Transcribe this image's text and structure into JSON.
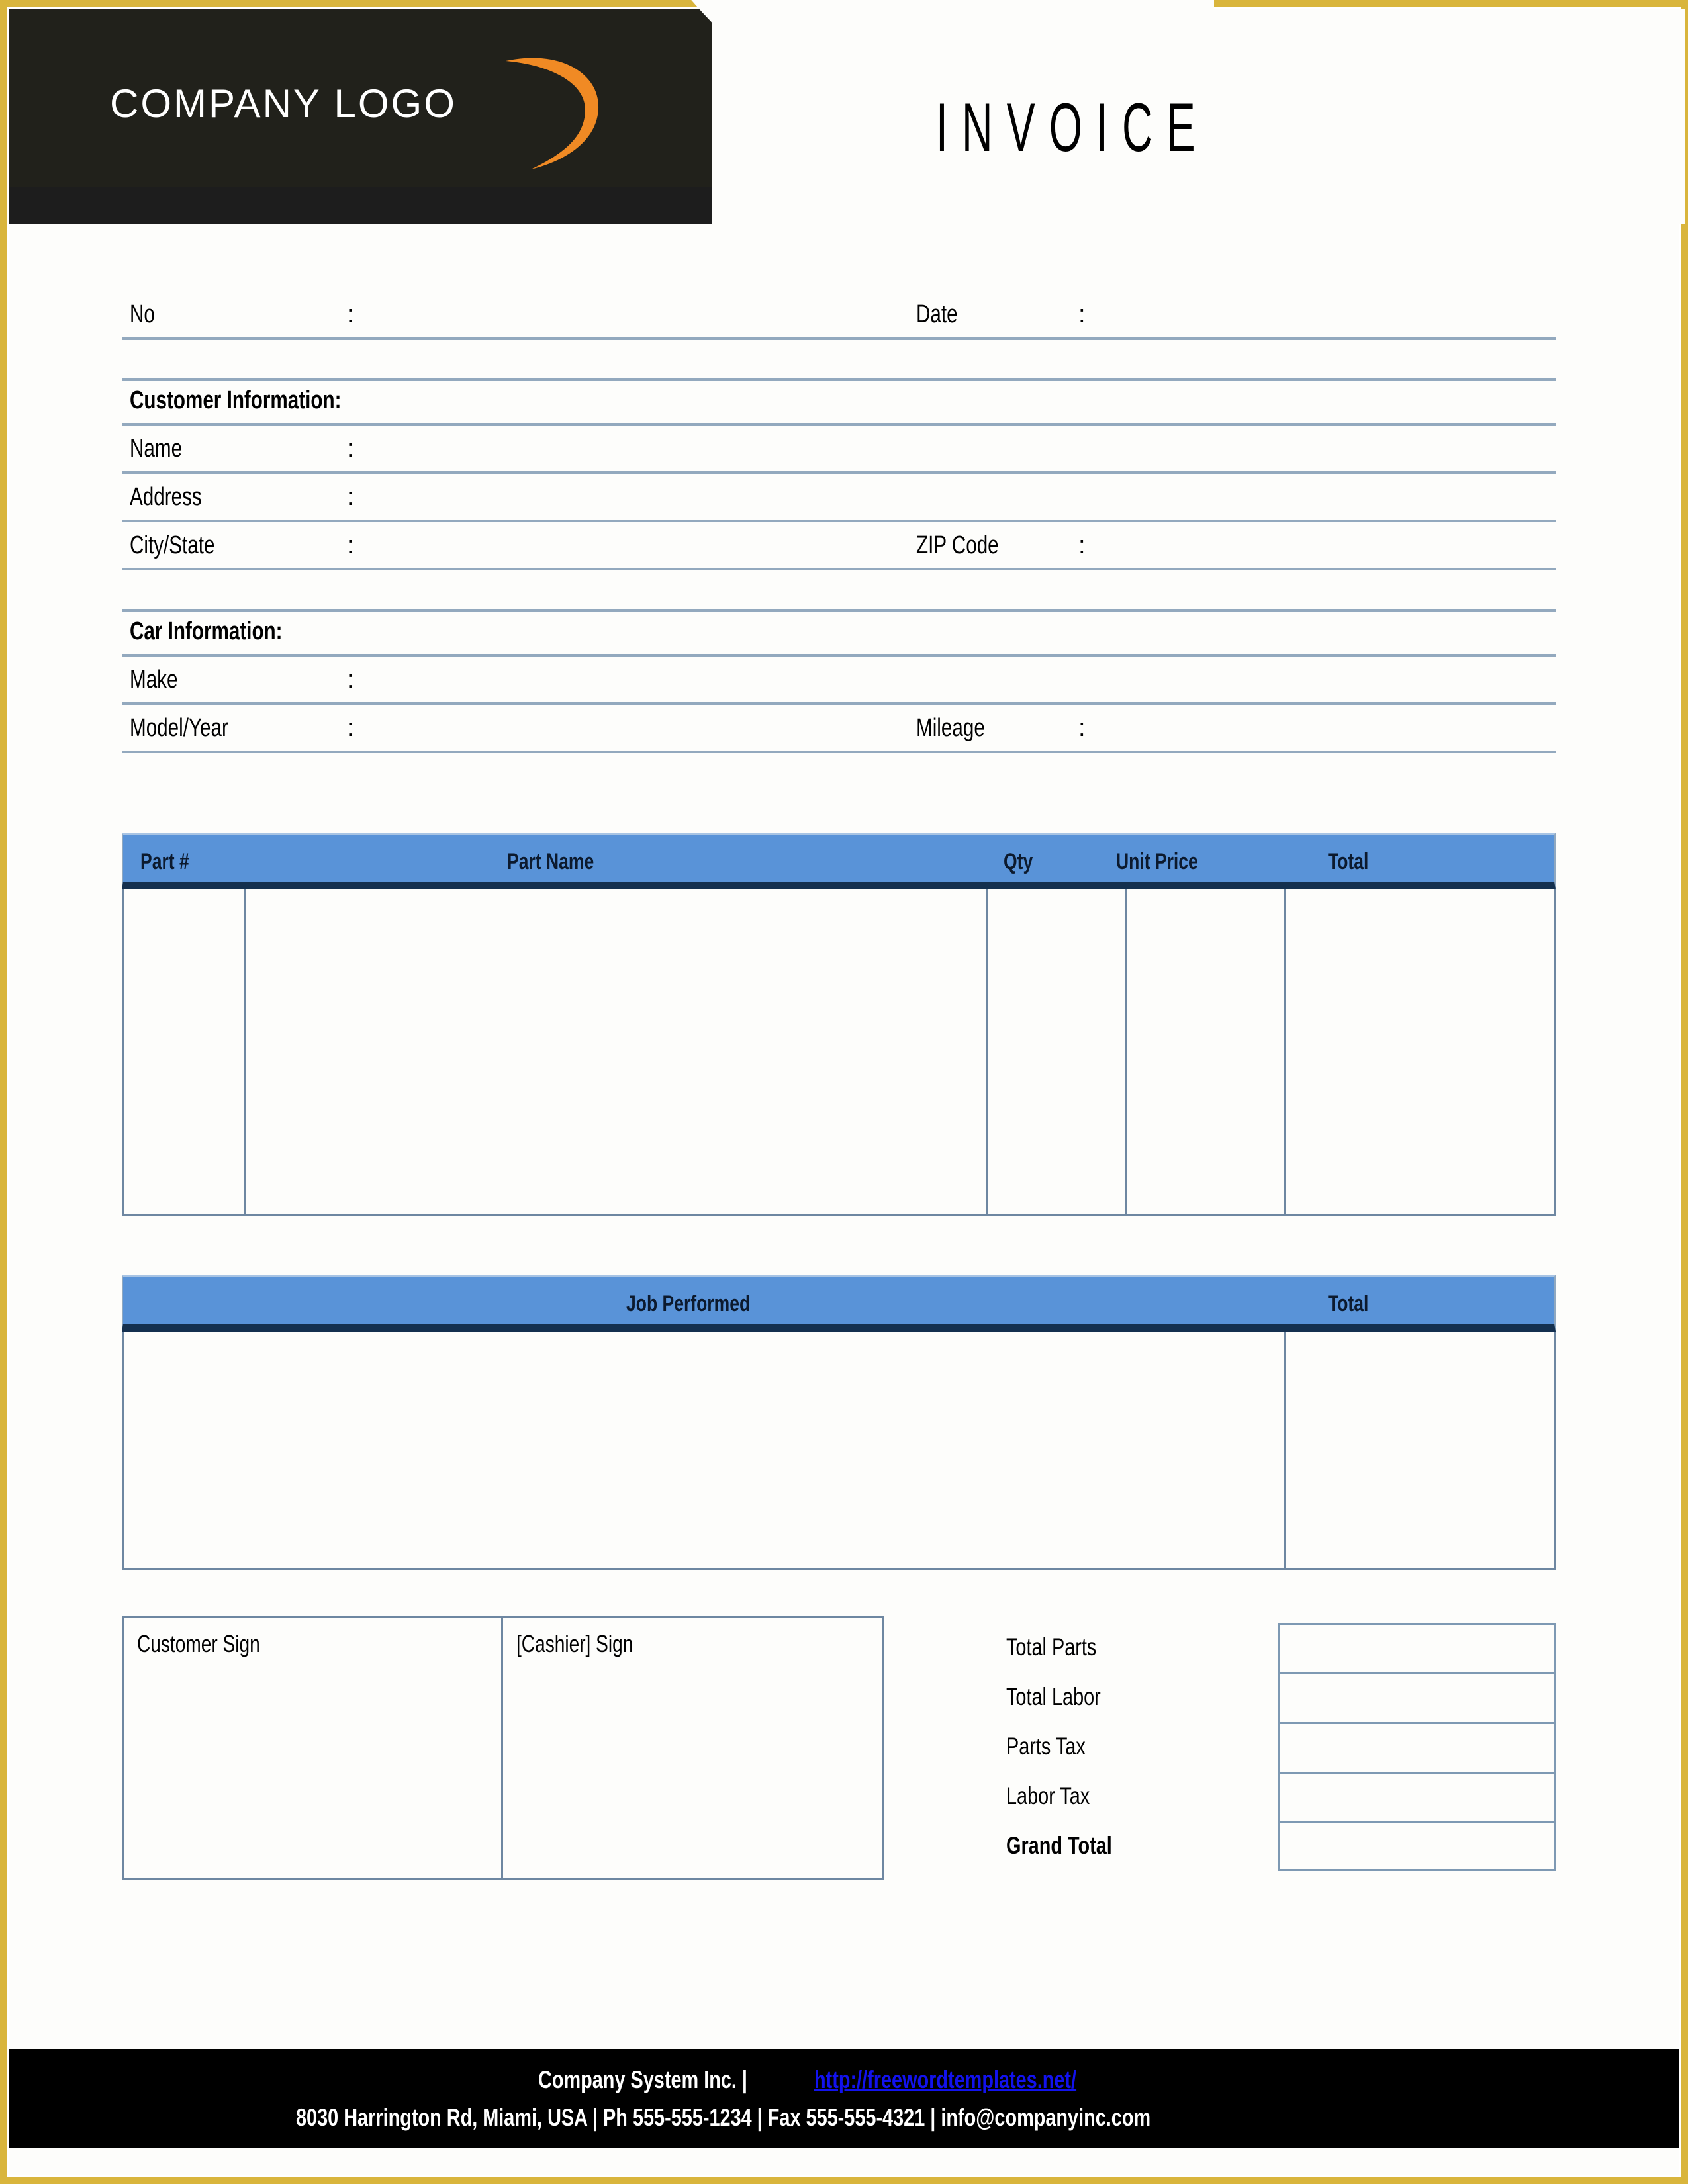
{
  "page": {
    "border_color": "#D9B53C",
    "background": "#FDFDFB"
  },
  "header": {
    "logo_text": "COMPANY LOGO",
    "logo_swoosh_color": "#F08A24",
    "band_color": "#21211B",
    "title": "INVOICE"
  },
  "meta": {
    "no_label": "No",
    "no_colon": ":",
    "date_label": "Date",
    "date_colon": ":",
    "no_value": "",
    "date_value": ""
  },
  "customer": {
    "section_title": "Customer Information:",
    "fields": [
      {
        "label": "Name",
        "colon": ":",
        "value": ""
      },
      {
        "label": "Address",
        "colon": ":",
        "value": ""
      },
      {
        "label": "City/State",
        "colon": ":",
        "value": "",
        "label2": "ZIP Code",
        "colon2": ":",
        "value2": ""
      }
    ]
  },
  "car": {
    "section_title": "Car Information:",
    "fields": [
      {
        "label": "Make",
        "colon": ":",
        "value": ""
      },
      {
        "label": "Model/Year",
        "colon": ":",
        "value": "",
        "label2": "Mileage",
        "colon2": ":",
        "value2": ""
      }
    ]
  },
  "parts_table": {
    "header_bg": "#5993D8",
    "header_rule": "#14304F",
    "columns": [
      {
        "label": "Part #"
      },
      {
        "label": "Part Name"
      },
      {
        "label": "Qty"
      },
      {
        "label": "Unit Price"
      },
      {
        "label": "Total"
      }
    ],
    "rows": []
  },
  "job_table": {
    "header_bg": "#5993D8",
    "columns": [
      {
        "label": "Job Performed"
      },
      {
        "label": "Total"
      }
    ],
    "rows": []
  },
  "signatures": {
    "customer_label": "Customer Sign",
    "cashier_label": "[Cashier] Sign"
  },
  "totals": {
    "rows": [
      {
        "label": "Total Parts",
        "value": "",
        "bold": false
      },
      {
        "label": "Total Labor",
        "value": "",
        "bold": false
      },
      {
        "label": "Parts Tax",
        "value": "",
        "bold": false
      },
      {
        "label": "Labor Tax",
        "value": "",
        "bold": false
      },
      {
        "label": "Grand Total",
        "value": "",
        "bold": true
      }
    ]
  },
  "footer": {
    "company": "Company System Inc. |",
    "url": "http://freewordtemplates.net/",
    "address_line": "8030 Harrington Rd, Miami, USA | Ph 555-555-1234 | Fax 555-555-4321 | info@companyinc.com"
  }
}
